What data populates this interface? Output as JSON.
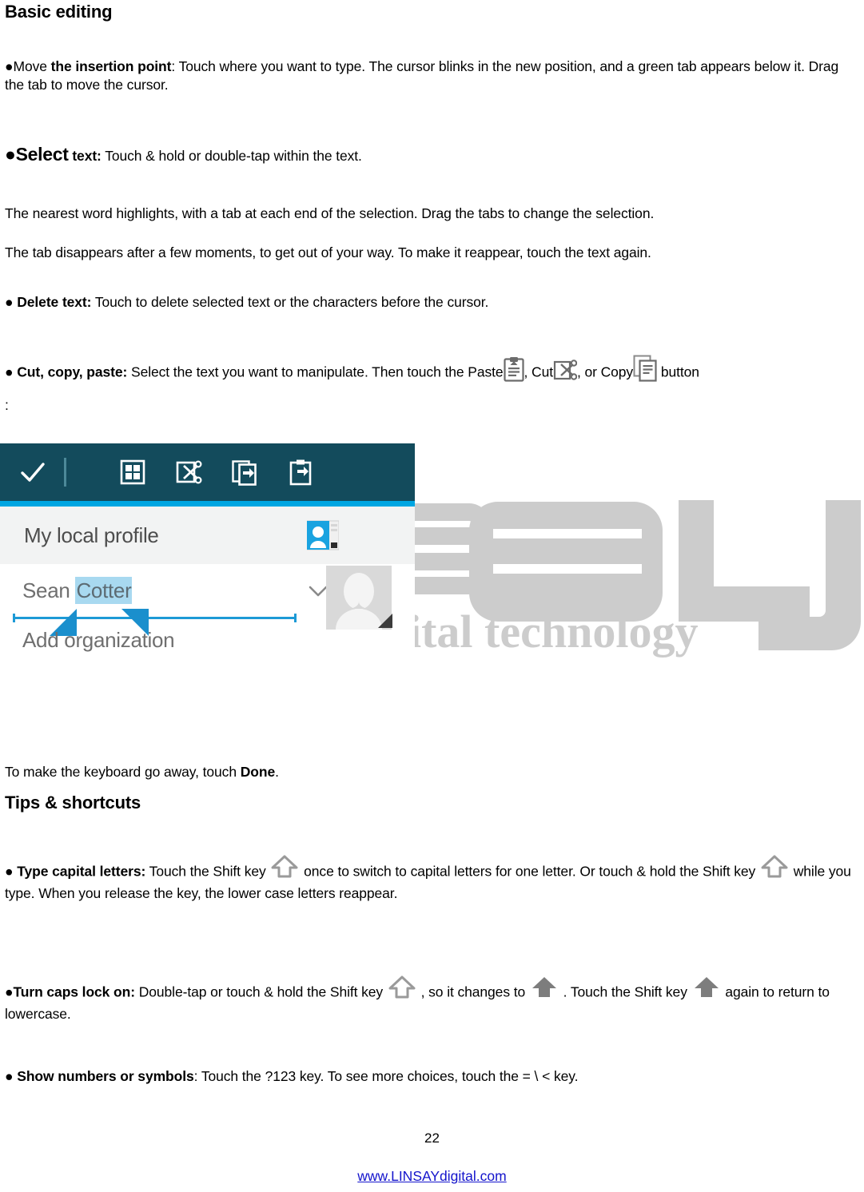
{
  "document": {
    "page_number": "22",
    "footer_link": "www.LINSAYdigital.com",
    "watermark_text": "ital technology"
  },
  "sections": {
    "basic_editing": {
      "heading": "Basic editing",
      "move_insertion_point": {
        "bullet": "●",
        "lead": "Move ",
        "bold_term": "the insertion point",
        "rest": ": Touch where you want to type. The cursor blinks in the new position, and a green tab appears below it. Drag the tab to move the cursor."
      },
      "select_text": {
        "bullet": "●",
        "bold_term": "Select",
        "bold_label": "text:",
        "rest": " Touch & hold or double-tap within the text."
      },
      "paragraph_highlight": "The nearest word highlights, with a tab at each end of the selection. Drag the tabs to change the selection.",
      "paragraph_disappear": "The tab disappears after a few moments, to get out of your way. To make it reappear, touch the text again.",
      "delete_text": {
        "bullet": "●",
        "bold_term": "Delete text:",
        "rest": " Touch to delete selected text or the characters before the cursor."
      },
      "cut_copy_paste": {
        "bullet": "●",
        "bold_term": "Cut, copy, paste:",
        "part1": " Select the text you want to manipulate. Then touch the Paste",
        "part2": ", Cut",
        "part3": ", or Copy",
        "part4": "button",
        "colon_line": ":"
      },
      "done_line": {
        "prefix": "To make the keyboard go away, touch ",
        "bold_term": "Done",
        "suffix": "."
      }
    },
    "tips_shortcuts": {
      "heading": "Tips & shortcuts",
      "type_capital_letters": {
        "bullet": "●",
        "bold_term": "Type capital letters:",
        "part1": " Touch the Shift key",
        "part2": "once to switch to capital letters for one letter. Or touch & hold the Shift key",
        "part3": "while you type. When you release the key, the lower case letters reappear."
      },
      "turn_caps_lock_on": {
        "bullet": "●",
        "bold_term": "Turn caps lock on:",
        "part1": " Double-tap or touch & hold the Shift key",
        "part2": ", so it changes to",
        "part3": ". Touch the Shift key",
        "part4": "again to return to lowercase."
      },
      "show_numbers_or_symbols": {
        "bullet": "●",
        "bold_term": "Show numbers or symbols",
        "rest": ": Touch the ?123 key. To see more choices, touch the = \\ < key."
      }
    }
  },
  "screenshot": {
    "toolbar": {
      "confirm_label": "check",
      "icons": [
        "select-all-icon",
        "cut-icon",
        "copy-icon",
        "paste-icon"
      ],
      "background_color": "#134b5c",
      "accent_color": "#00a6e2"
    },
    "profile_row": {
      "label": "My local profile",
      "icon": "contact-card-icon"
    },
    "contact": {
      "name_unselected": "Sean ",
      "name_selected": "Cotter",
      "add_organization": "Add organization",
      "selection_color": "#a8d9f0",
      "handle_color": "#1a8fcd"
    }
  }
}
